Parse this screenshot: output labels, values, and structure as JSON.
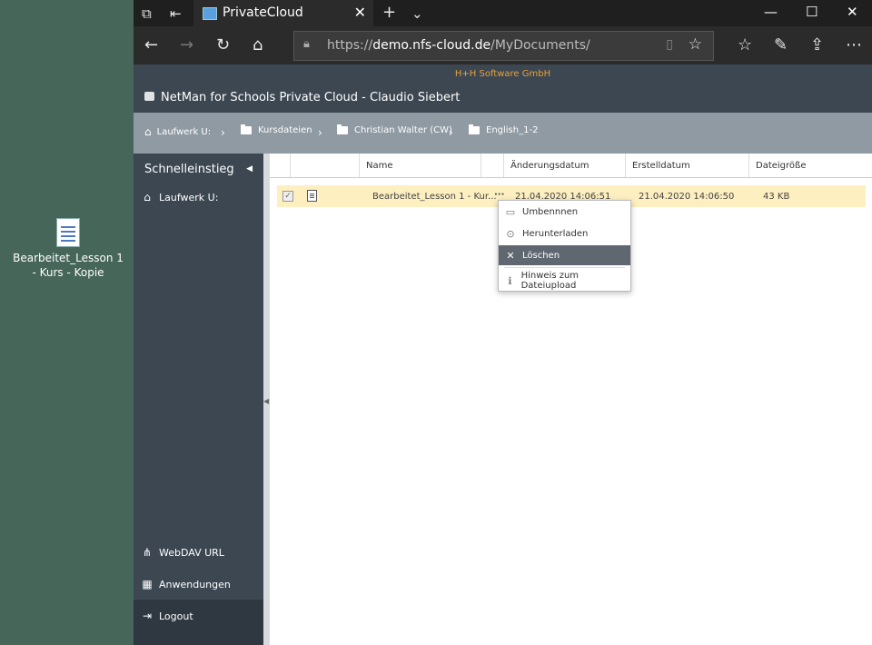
{
  "desktop": {
    "file_label": "Bearbeitet_Lesson 1 - Kurs - Kopie"
  },
  "browser": {
    "tab_title": "PrivateCloud",
    "url_prefix": "https://",
    "url_host": "demo.nfs-cloud.de",
    "url_path": "/MyDocuments/"
  },
  "app": {
    "company": "H+H Software GmbH",
    "title": "NetMan for Schools Private Cloud - Claudio Siebert",
    "accent_color": "#e6a23c"
  },
  "breadcrumb": [
    "Laufwerk U:",
    "Kursdateien",
    "Christian Walter (CW)",
    "English_1-2"
  ],
  "sidebar": {
    "header": "Schnelleinstieg",
    "items": [
      {
        "label": "Laufwerk U:",
        "icon": "home-icon"
      }
    ],
    "footer": [
      {
        "label": "WebDAV URL",
        "icon": "share-icon"
      },
      {
        "label": "Anwendungen",
        "icon": "grid-icon"
      },
      {
        "label": "Logout",
        "icon": "logout-icon"
      }
    ]
  },
  "table": {
    "columns": [
      "Name",
      "Änderungsdatum",
      "Erstelldatum",
      "Dateigröße"
    ],
    "rows": [
      {
        "name": "Bearbeitet_Lesson 1 - Kur...",
        "modified": "21.04.2020 14:06:51",
        "created": "21.04.2020 14:06:50",
        "size": "43 KB"
      }
    ]
  },
  "context_menu": {
    "items": [
      {
        "label": "Umbennnen",
        "icon": "rename-icon"
      },
      {
        "label": "Herunterladen",
        "icon": "download-icon"
      },
      {
        "label": "Löschen",
        "icon": "delete-icon",
        "highlighted": true
      },
      {
        "label": "Hinweis zum Dateiupload",
        "icon": "info-icon"
      }
    ]
  }
}
